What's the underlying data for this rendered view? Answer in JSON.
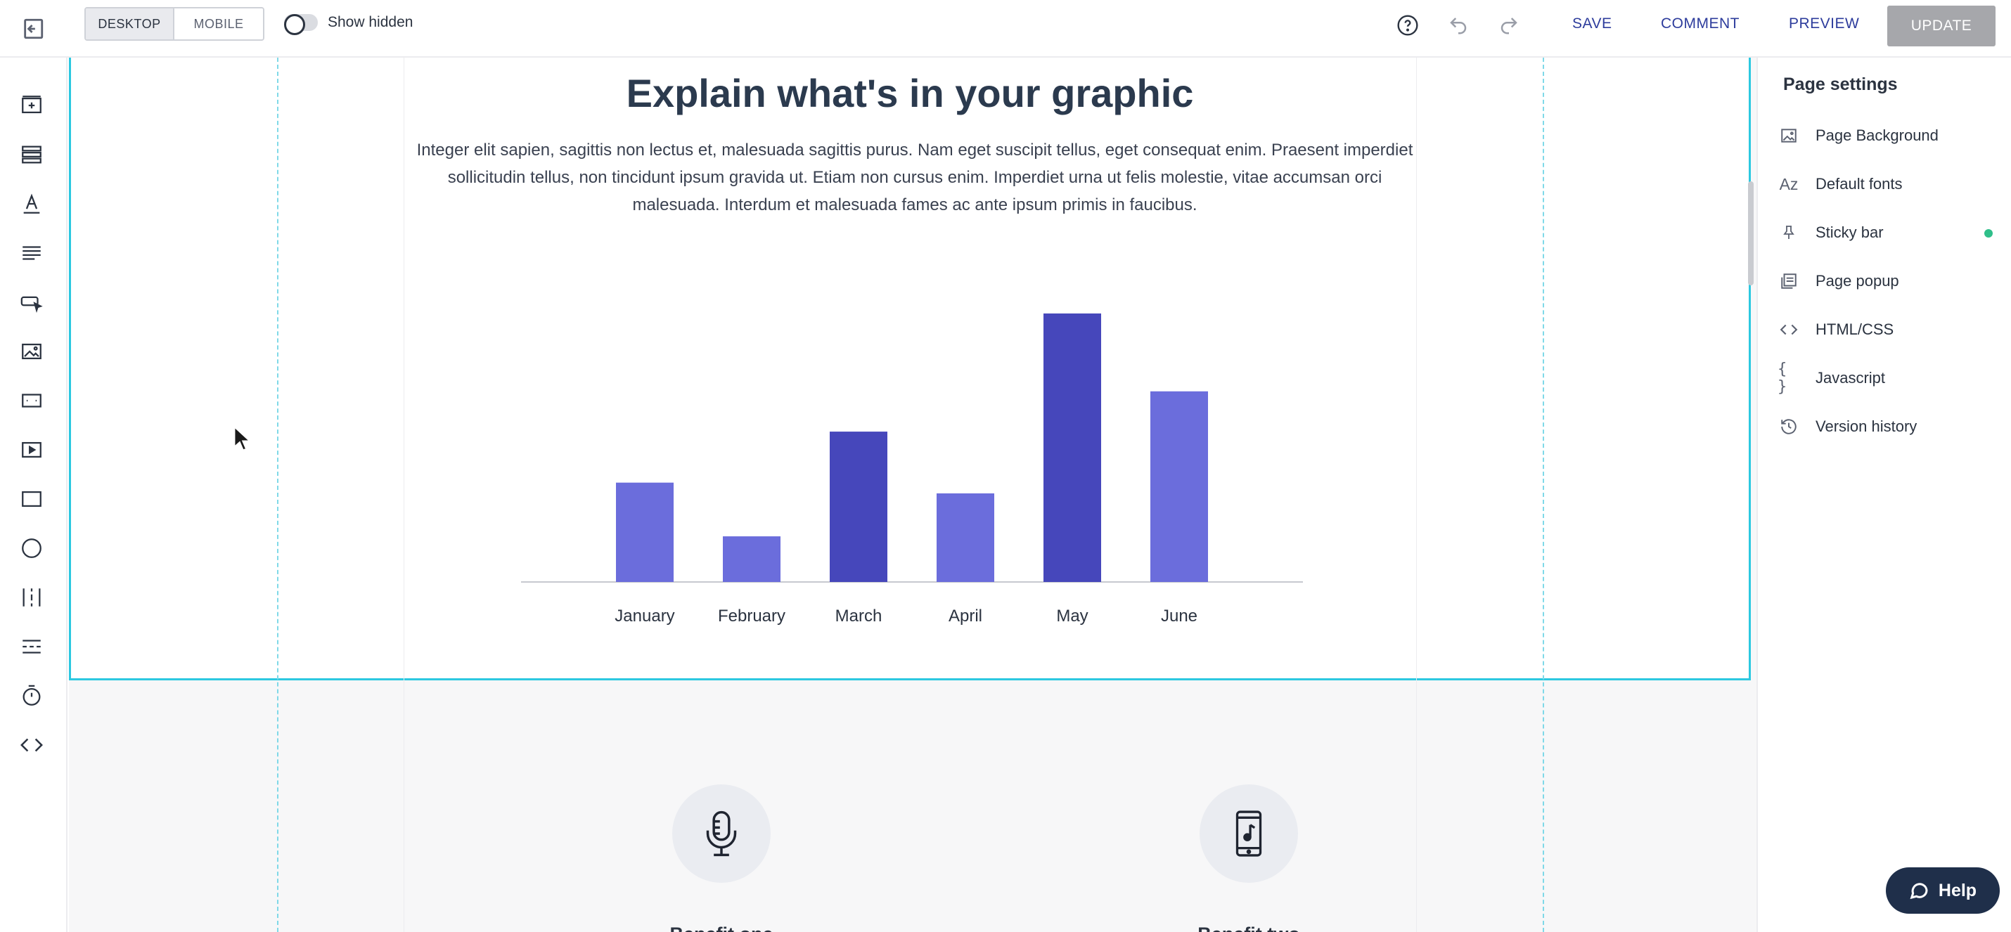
{
  "toolbar": {
    "view_desktop": "DESKTOP",
    "view_mobile": "MOBILE",
    "show_hidden": "Show hidden",
    "save": "SAVE",
    "comment": "COMMENT",
    "preview": "PREVIEW",
    "update": "UPDATE"
  },
  "left_rail": {
    "icons": [
      "add-section-icon",
      "rows-icon",
      "text-icon",
      "paragraph-icon",
      "button-icon",
      "image-icon",
      "box-icon",
      "video-icon",
      "rectangle-icon",
      "circle-icon",
      "columns-icon",
      "divider-icon",
      "timer-icon",
      "code-icon"
    ]
  },
  "canvas": {
    "heading": "Explain what's in your graphic",
    "description": "Integer elit sapien, sagittis non lectus et, malesuada sagittis purus. Nam eget suscipit tellus, eget consequat enim. Praesent imperdiet sollicitudin tellus, non tincidunt ipsum gravida ut. Etiam non cursus enim. Imperdiet urna ut felis molestie, vitae accumsan orci malesuada. Interdum et malesuada fames ac ante ipsum primis in faucibus.",
    "benefits": [
      {
        "title": "Benefit one",
        "icon": "microphone-icon"
      },
      {
        "title": "Benefit two",
        "icon": "phone-music-icon"
      }
    ]
  },
  "chart_data": {
    "type": "bar",
    "categories": [
      "January",
      "February",
      "March",
      "April",
      "May",
      "June"
    ],
    "values": [
      37,
      17,
      56,
      33,
      100,
      71
    ],
    "colors": [
      "#6b6ddc",
      "#6b6ddc",
      "#4647bb",
      "#6b6ddc",
      "#4647bb",
      "#6b6ddc"
    ],
    "title": "",
    "xlabel": "",
    "ylabel": "",
    "ylim": [
      0,
      100
    ],
    "grid": false
  },
  "right_panel": {
    "title": "Page settings",
    "items": [
      {
        "label": "Page Background",
        "icon": "image-icon",
        "dot": false
      },
      {
        "label": "Default fonts",
        "icon": "fonts-icon",
        "dot": false
      },
      {
        "label": "Sticky bar",
        "icon": "pin-icon",
        "dot": true
      },
      {
        "label": "Page popup",
        "icon": "popup-icon",
        "dot": false
      },
      {
        "label": "HTML/CSS",
        "icon": "code-icon",
        "dot": false
      },
      {
        "label": "Javascript",
        "icon": "braces-icon",
        "dot": false
      },
      {
        "label": "Version history",
        "icon": "history-icon",
        "dot": false
      }
    ],
    "active_dot_color": "#2fbf8a"
  },
  "help": {
    "label": "Help"
  }
}
